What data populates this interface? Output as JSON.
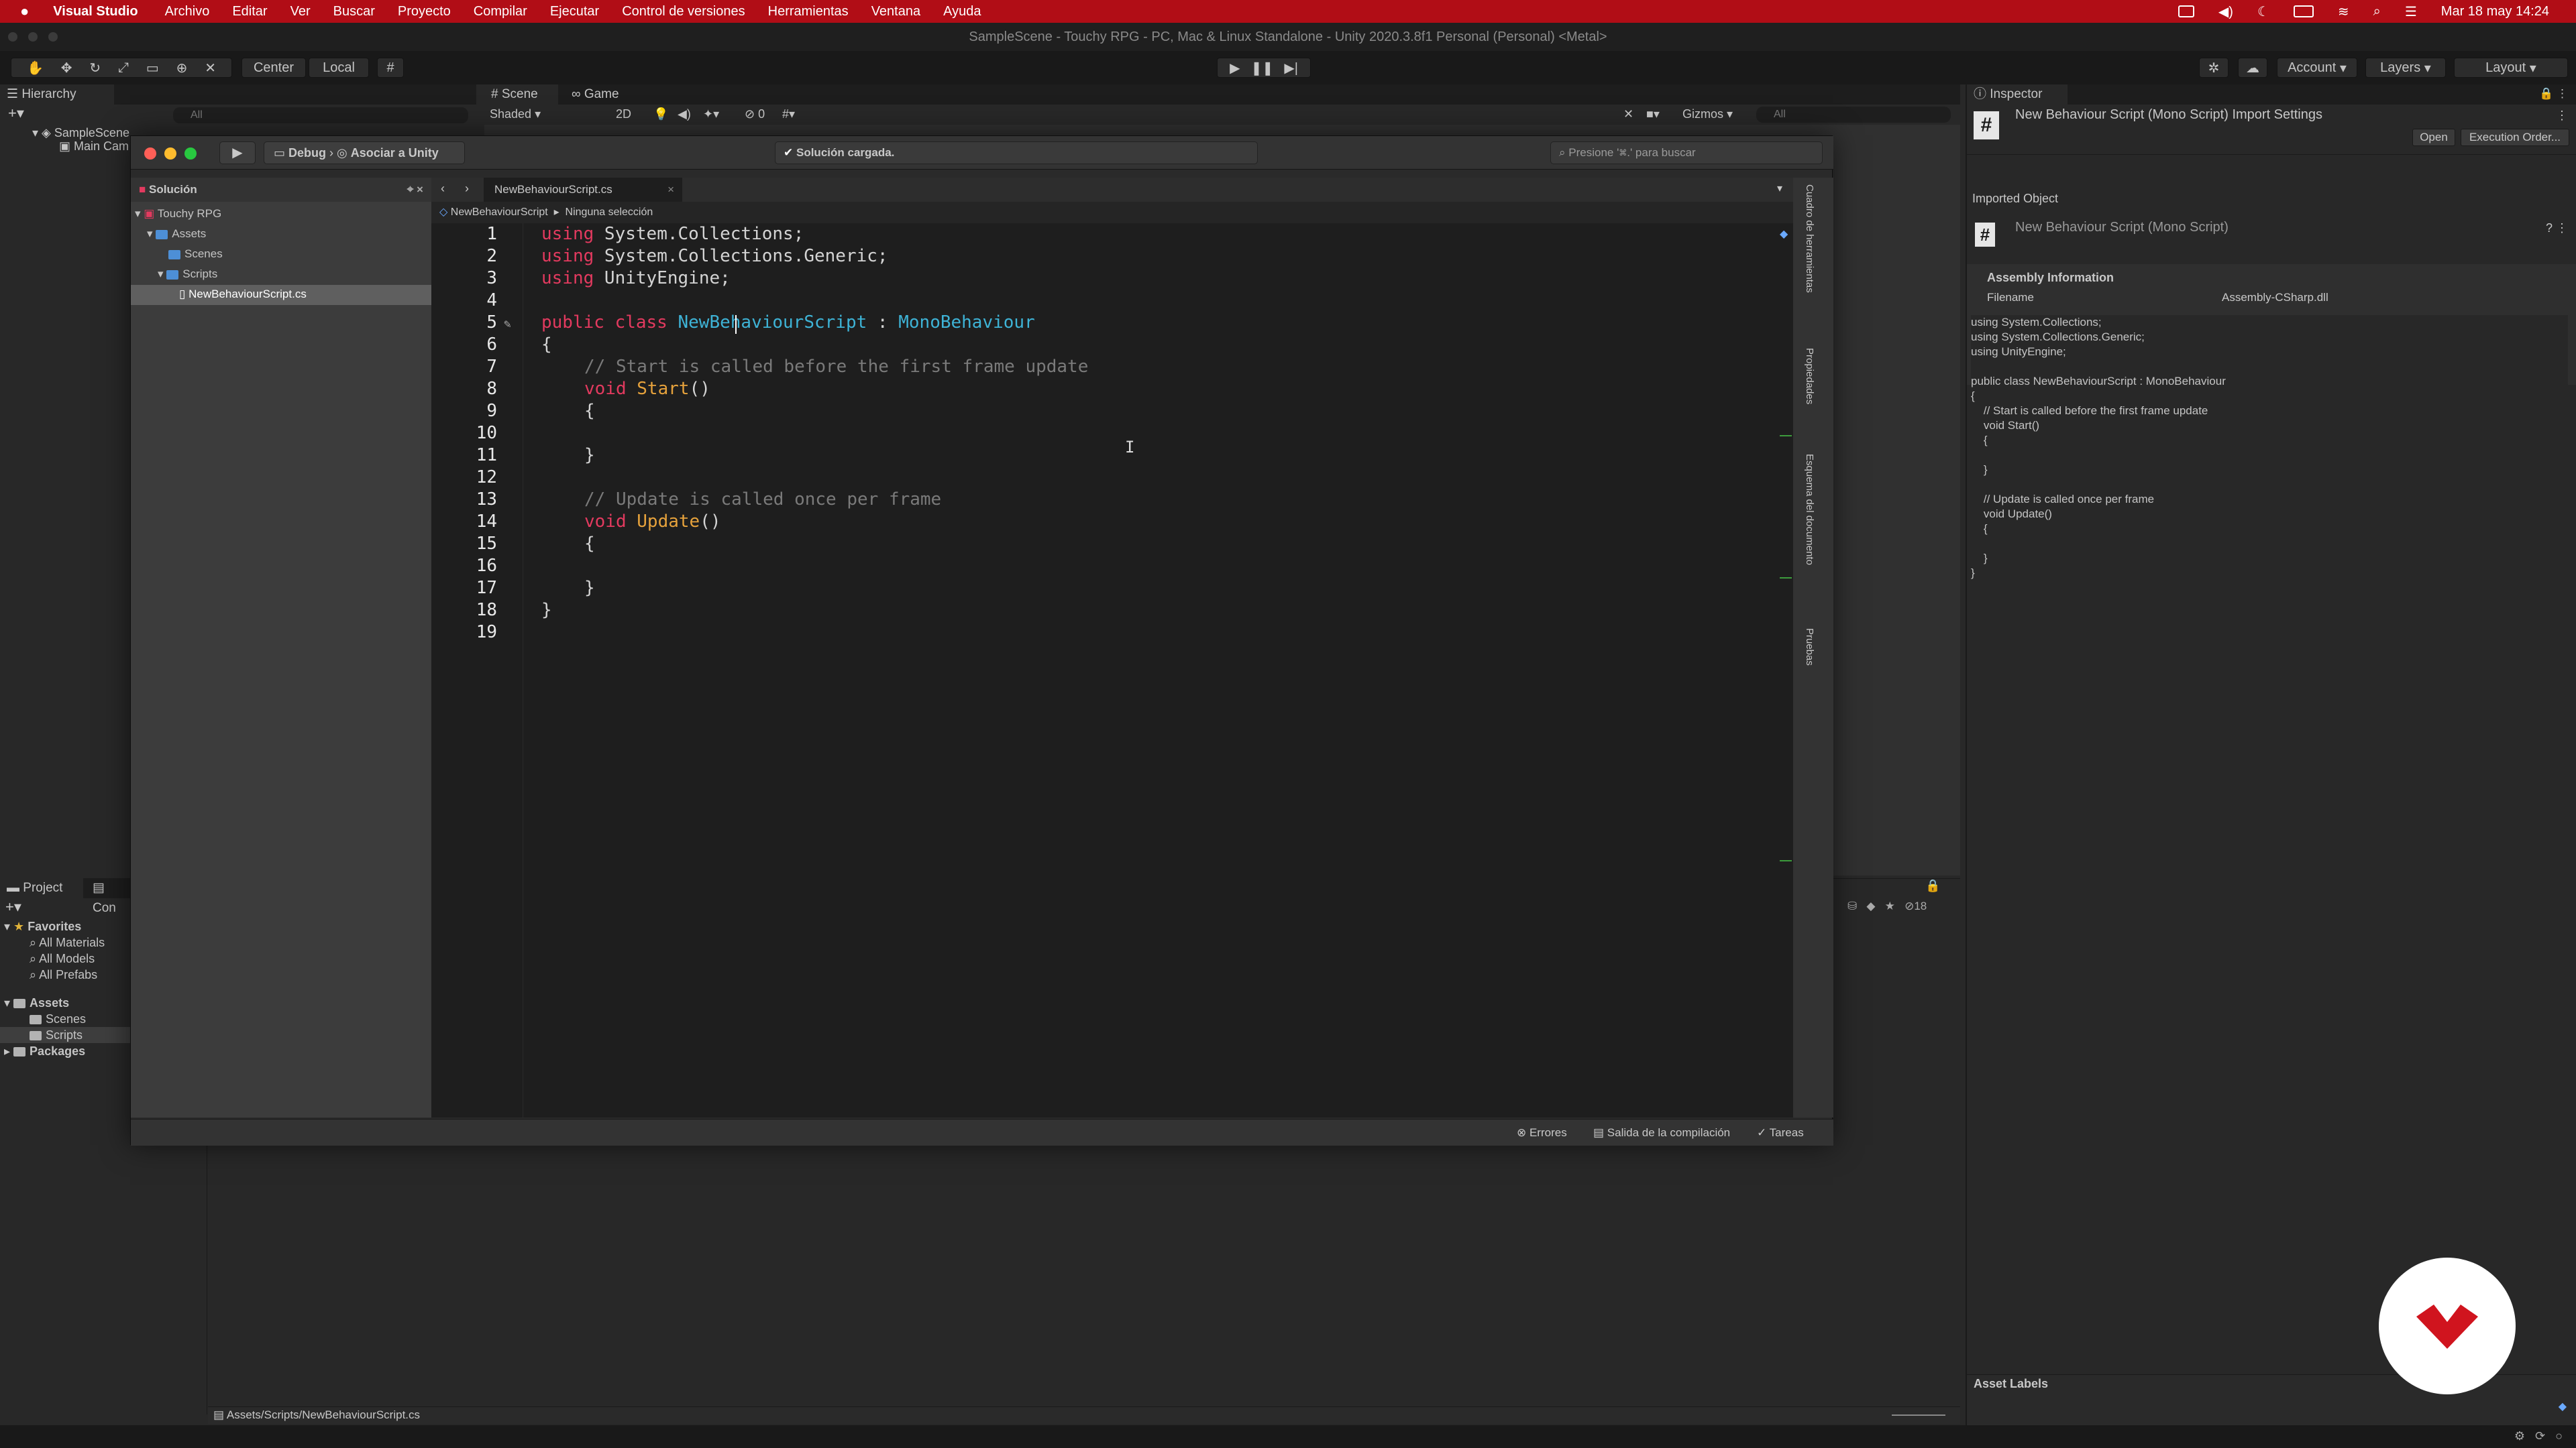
{
  "menubar": {
    "app": "Visual Studio",
    "items": [
      "Archivo",
      "Editar",
      "Ver",
      "Buscar",
      "Proyecto",
      "Compilar",
      "Ejecutar",
      "Control de versiones",
      "Herramientas",
      "Ventana",
      "Ayuda"
    ],
    "clock": "Mar 18 may  14:24"
  },
  "unity": {
    "title": "SampleScene - Touchy RPG - PC, Mac & Linux Standalone - Unity 2020.3.8f1 Personal (Personal) <Metal>",
    "toolbar": {
      "pivot": "Center",
      "space": "Local",
      "account": "Account",
      "layers": "Layers",
      "layout": "Layout"
    },
    "hierarchy": {
      "tab": "Hierarchy",
      "search_placeholder": "All",
      "items": [
        "SampleScene",
        "Main Cam"
      ]
    },
    "scene": {
      "tab_scene": "Scene",
      "tab_game": "Game",
      "shading": "Shaded",
      "mode_2d": "2D",
      "gizmos": "Gizmos",
      "search_placeholder": "All",
      "hidden_count": "0"
    },
    "project": {
      "tab_project": "Project",
      "tab_console": "Con",
      "favorites": "Favorites",
      "fav_items": [
        "All Materials",
        "All Models",
        "All Prefabs"
      ],
      "assets": "Assets",
      "asset_items": [
        "Scenes",
        "Scripts"
      ],
      "packages": "Packages",
      "count": "18",
      "path": "Assets/Scripts/NewBehaviourScript.cs"
    },
    "inspector": {
      "tab": "Inspector",
      "title": "New Behaviour Script (Mono Script) Import Settings",
      "open": "Open",
      "exec_order": "Execution Order...",
      "imported_object": "Imported Object",
      "object_name": "New Behaviour Script (Mono Script)",
      "assembly_info": "Assembly Information",
      "filename_label": "Filename",
      "filename_value": "Assembly-CSharp.dll",
      "preview": "using System.Collections;\nusing System.Collections.Generic;\nusing UnityEngine;\n\npublic class NewBehaviourScript : MonoBehaviour\n{\n    // Start is called before the first frame update\n    void Start()\n    {\n        \n    }\n\n    // Update is called once per frame\n    void Update()\n    {\n        \n    }\n}",
      "asset_labels": "Asset Labels"
    }
  },
  "vs": {
    "config": "Debug",
    "target": "Asociar a Unity",
    "status": "Solución cargada.",
    "search_placeholder": "Presione '⌘.' para buscar",
    "solution_label": "Solución",
    "tree": {
      "root": "Touchy RPG",
      "assets": "Assets",
      "scenes": "Scenes",
      "scripts": "Scripts",
      "file": "NewBehaviourScript.cs"
    },
    "tab": "NewBehaviourScript.cs",
    "breadcrumb_class": "NewBehaviourScript",
    "breadcrumb_member": "Ninguna selección",
    "side_tabs": [
      "Cuadro de herramientas",
      "Propiedades",
      "Esquema del documento",
      "Pruebas"
    ],
    "status_errors": "Errores",
    "status_build": "Salida de la compilación",
    "status_tasks": "Tareas",
    "line_numbers": [
      "1",
      "2",
      "3",
      "4",
      "5",
      "6",
      "7",
      "8",
      "9",
      "10",
      "11",
      "12",
      "13",
      "14",
      "15",
      "16",
      "17",
      "18",
      "19"
    ],
    "code": {
      "l1_kw": "using",
      "l1_rest": " System.Collections;",
      "l2_kw": "using",
      "l2_rest": " System.Collections.Generic;",
      "l3_kw": "using",
      "l3_rest": " UnityEngine;",
      "l5_kw": "public class",
      "l5_cls": " NewBehaviourScript",
      "l5_colon": " : ",
      "l5_base": "MonoBehaviour",
      "l6": "{",
      "l7_cm": "// Start is called before the first frame update",
      "l8_kw": "void",
      "l8_fn": " Start",
      "l8_p": "()",
      "l9": "{",
      "l11": "}",
      "l13_cm": "// Update is called once per frame",
      "l14_kw": "void",
      "l14_fn": " Update",
      "l14_p": "()",
      "l15": "{",
      "l17": "}",
      "l18": "}"
    }
  },
  "colors": {
    "menubar": "#b10d16",
    "keyword": "#e33a5f",
    "type": "#3eb3d6",
    "comment": "#7a7a7a",
    "function": "#e6a23c",
    "logo": "#d0141e"
  }
}
